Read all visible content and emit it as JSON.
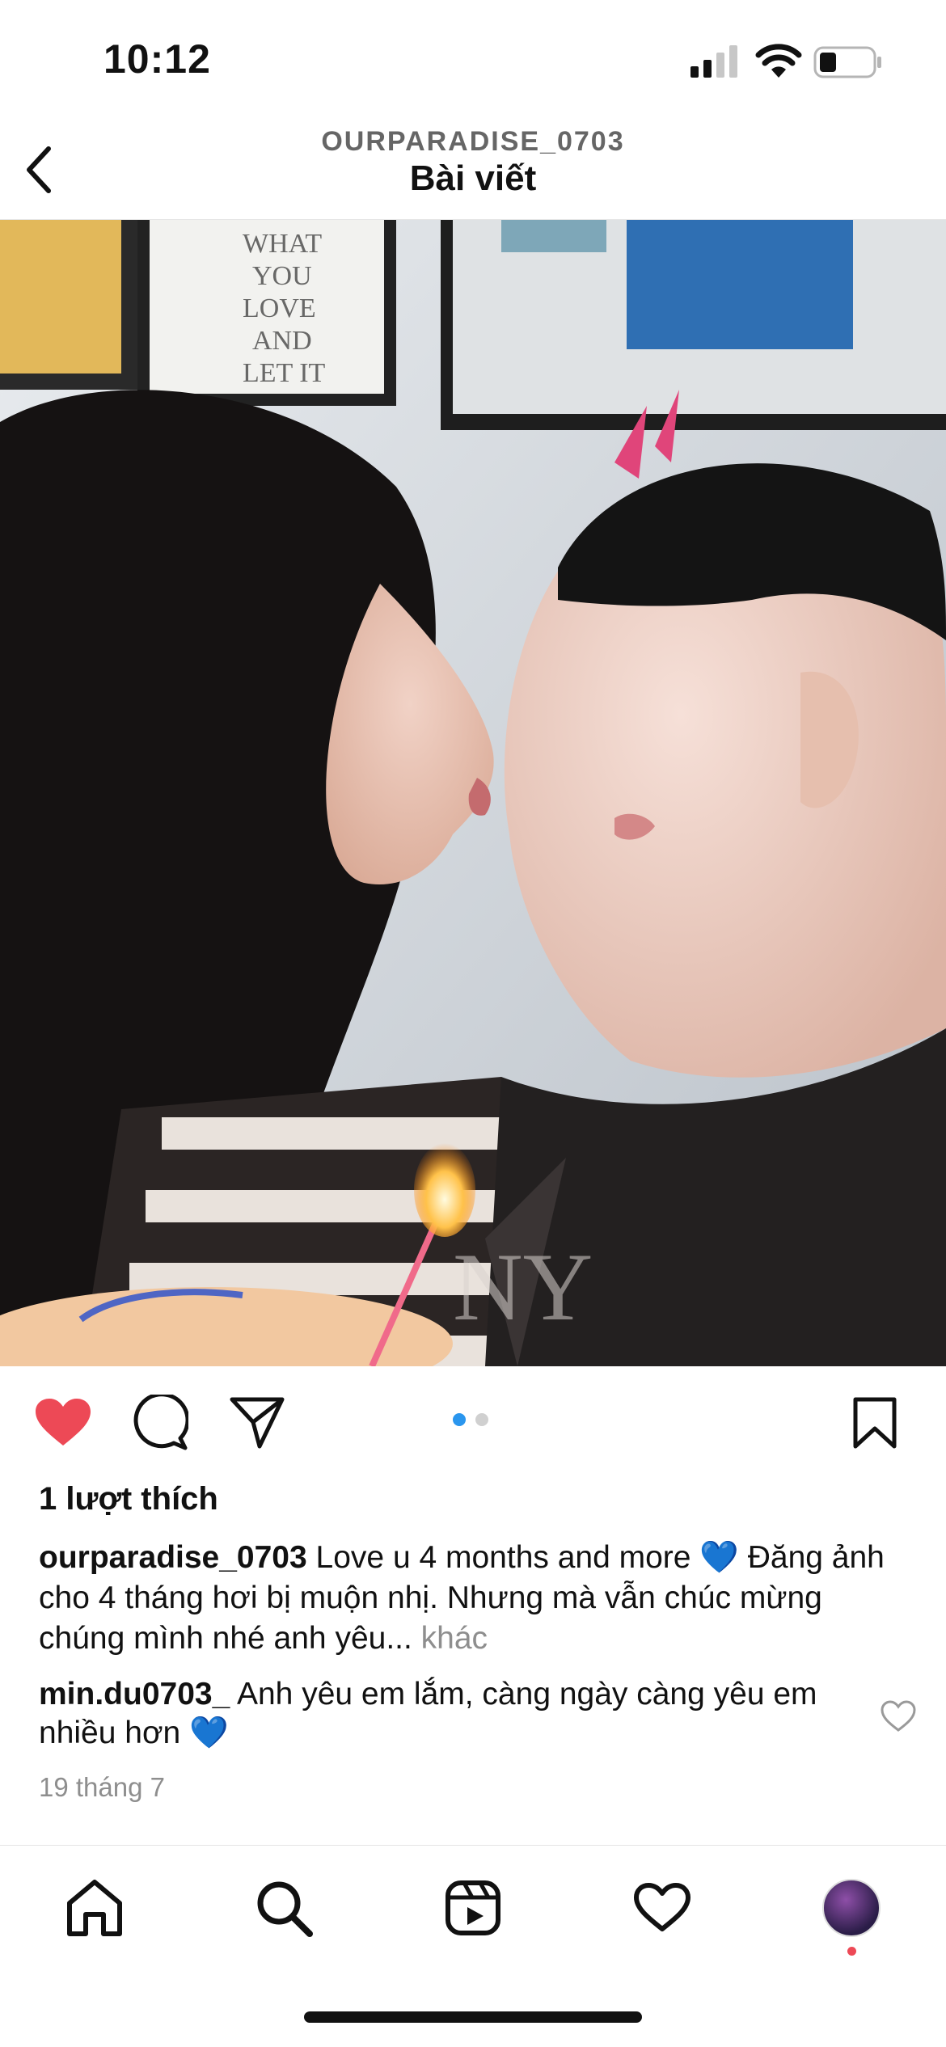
{
  "status_bar": {
    "time": "10:12",
    "icons": [
      "cellular-signal-icon",
      "wifi-icon",
      "battery-icon"
    ]
  },
  "header": {
    "username": "OURPARADISE_0703",
    "title": "Bài viết",
    "back_icon": "chevron-left-icon"
  },
  "post": {
    "image_alt": "",
    "carousel": {
      "count": 2,
      "active_index": 0
    },
    "actions": [
      "heart-filled-icon",
      "comment-icon",
      "share-icon",
      "bookmark-icon"
    ],
    "likes_text": "1 lượt thích",
    "caption": {
      "username": "ourparadise_0703",
      "text": " Love u 4 months and more 💙 Đăng ảnh cho 4 tháng hơi bị muộn nhị. Nhưng mà vẫn chúc mừng chúng mình nhé anh yêu...",
      "more_label": " khác"
    },
    "comment": {
      "username": "min.du0703_",
      "text": " Anh yêu em lắm, càng ngày càng yêu em nhiều hơn 💙"
    },
    "date": "19 tháng 7"
  },
  "tabbar": {
    "items": [
      "home-icon",
      "search-icon",
      "reels-icon",
      "heart-icon",
      "profile-avatar"
    ]
  },
  "colors": {
    "like_red": "#ed4956",
    "carousel_active": "#2a96ee",
    "muted_text": "#8e8e8e",
    "heart_blue": "#1e74e6"
  }
}
